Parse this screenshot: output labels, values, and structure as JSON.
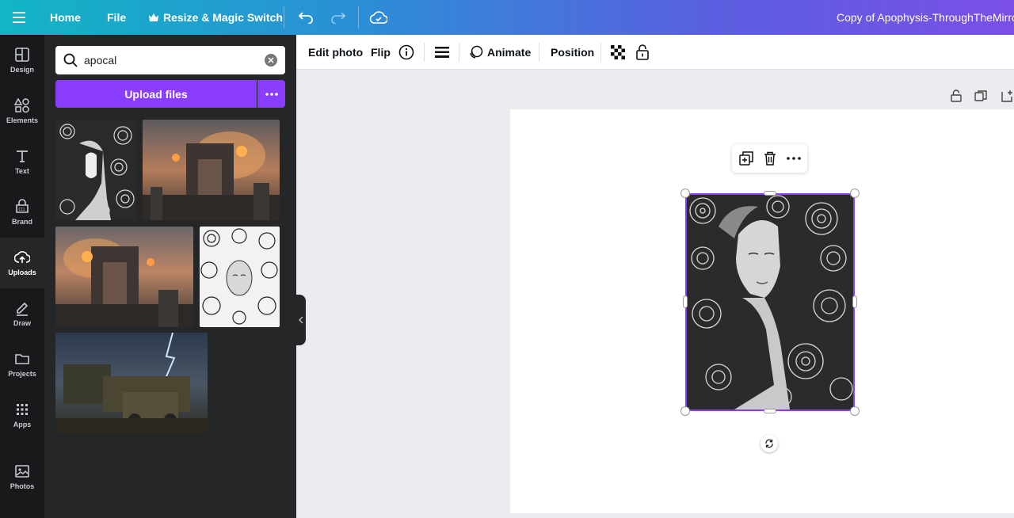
{
  "topbar": {
    "home": "Home",
    "file": "File",
    "resize": "Resize & Magic Switch",
    "title": "Copy of Apophysis-ThroughTheMirro"
  },
  "rail": {
    "items": [
      {
        "label": "Design",
        "icon": "layout-icon"
      },
      {
        "label": "Elements",
        "icon": "shapes-icon"
      },
      {
        "label": "Text",
        "icon": "text-icon"
      },
      {
        "label": "Brand",
        "icon": "brand-icon"
      },
      {
        "label": "Uploads",
        "icon": "cloud-upload-icon",
        "active": true
      },
      {
        "label": "Draw",
        "icon": "pen-icon"
      },
      {
        "label": "Projects",
        "icon": "folder-icon"
      },
      {
        "label": "Apps",
        "icon": "grid-icon"
      },
      {
        "label": "Photos",
        "icon": "image-icon"
      }
    ]
  },
  "panel": {
    "search_value": "apocal",
    "upload_label": "Upload files"
  },
  "context_toolbar": {
    "edit_photo": "Edit photo",
    "flip": "Flip",
    "animate": "Animate",
    "position": "Position"
  },
  "colors": {
    "accent": "#8b3dff",
    "panel_bg": "#252627",
    "rail_bg": "#18191b"
  }
}
